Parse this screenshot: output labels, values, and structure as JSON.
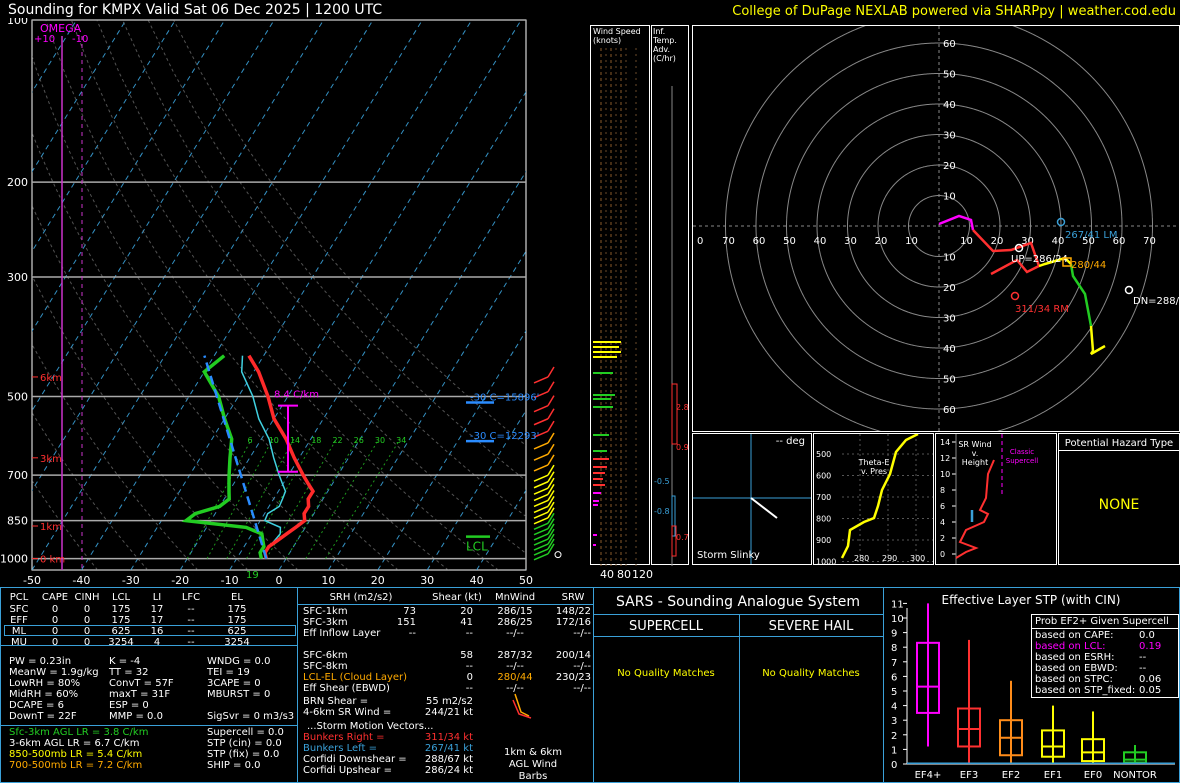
{
  "header": {
    "left": "Sounding for KMPX Valid  Sat 06 Dec 2025 | 1200 UTC",
    "right": "College of DuPage NEXLAB powered via SHARPpy | weather.cod.edu"
  },
  "colors": {
    "temp": "#ff2a2a",
    "dew": "#22cc22",
    "wet": "#40d0e0",
    "accent_yellow": "#ffff00",
    "omega": "#ff00ff",
    "frame": "#3aa0d8"
  },
  "chart_data": [
    {
      "type": "line",
      "name": "skew-t",
      "ylabel": "",
      "yticks": [
        "100",
        "200",
        "300",
        "500",
        "700",
        "850",
        "1000"
      ],
      "ytick_values": [
        100,
        200,
        300,
        500,
        700,
        850,
        1000
      ],
      "xticks": [
        "-50",
        "-40",
        "-30",
        "-20",
        "-10",
        "0",
        "10",
        "20",
        "30",
        "40",
        "50"
      ],
      "xtick_values": [
        -50,
        -40,
        -30,
        -20,
        -10,
        0,
        10,
        20,
        30,
        40,
        50
      ],
      "xlim": [
        -50,
        50
      ],
      "ylim": [
        1050,
        100
      ],
      "omega_label": "OMEGA",
      "omega_ticks": [
        "+10",
        "-10"
      ],
      "heights": [
        "6km",
        "3km",
        "1km",
        "0 km"
      ],
      "height_p": [
        460,
        650,
        870,
        1000
      ],
      "lapse_label": "8.4 C/km",
      "lcl_label": "LCL",
      "sfc_label": "19",
      "isotherm_labels": [
        "-30 C=15896'",
        "-30 C=12293'"
      ],
      "mixratio_labels": [
        "6",
        "10",
        "14",
        "18",
        "22",
        "26",
        "30",
        "34"
      ],
      "series": [
        {
          "name": "temp",
          "p": [
            1000,
            975,
            950,
            925,
            900,
            875,
            850,
            825,
            800,
            775,
            750,
            725,
            700,
            650,
            600,
            550,
            500,
            450,
            420
          ],
          "t": [
            -4,
            -5,
            -5,
            -4,
            -3,
            -2,
            -1,
            -2,
            -2,
            -3,
            -3,
            -5,
            -7,
            -11,
            -15,
            -20,
            -24,
            -29,
            -33
          ]
        },
        {
          "name": "dew",
          "p": [
            1000,
            975,
            950,
            925,
            900,
            875,
            850,
            825,
            800,
            775,
            750,
            725,
            700,
            650,
            600,
            550,
            500,
            450,
            420
          ],
          "t": [
            -5,
            -6,
            -6,
            -7,
            -8,
            -12,
            -25,
            -24,
            -20,
            -19,
            -20,
            -21,
            -22,
            -24,
            -26,
            -30,
            -34,
            -40,
            -38
          ]
        }
      ]
    },
    {
      "type": "bar",
      "name": "wind-speed",
      "title": "Wind Speed (knots)",
      "xticks": [
        "40",
        "80",
        "120"
      ]
    },
    {
      "type": "bar",
      "name": "inferred-temp-adv",
      "title": "Inf. Temp. Adv.(C/hr)",
      "values": [
        2.8,
        0.9,
        -0.5,
        -0.8,
        0.7
      ],
      "labels": [
        "2.8",
        "0.9",
        "-0.5",
        "-0.8",
        "0.7"
      ]
    },
    {
      "type": "line",
      "name": "hodograph",
      "rings": [
        "10",
        "20",
        "30",
        "40",
        "50",
        "60",
        "70"
      ],
      "points": [
        {
          "label": "267/41 LM",
          "c": "#3aa0d8"
        },
        {
          "label": "UP=286/24",
          "c": "#ffffff"
        },
        {
          "label": "280/44",
          "c": "#ffaa00"
        },
        {
          "label": "311/34 RM",
          "c": "#ff3030"
        },
        {
          "label": "DN=288/6",
          "c": "#ffffff"
        }
      ]
    },
    {
      "type": "line",
      "name": "theta-e",
      "title": "Theta-E v. Pres",
      "yticks": [
        "500",
        "600",
        "700",
        "800",
        "900",
        "1000"
      ],
      "xticks": [
        "280",
        "290",
        "300"
      ]
    },
    {
      "type": "line",
      "name": "sr-wind",
      "title": "SR Wind v. Height",
      "yticks": [
        "14",
        "12",
        "10",
        "8",
        "6",
        "4",
        "2",
        "0"
      ],
      "note": "Classic Supercell"
    },
    {
      "type": "bar",
      "name": "stp",
      "title": "Effective Layer STP (with CIN)",
      "categories": [
        "EF4+",
        "EF3",
        "EF2",
        "EF1",
        "EF0",
        "NONTOR"
      ],
      "yticks": [
        "0",
        "1",
        "2",
        "3",
        "4",
        "5",
        "6",
        "7",
        "8",
        "9",
        "10",
        "11"
      ],
      "ylim": [
        0,
        11
      ]
    }
  ],
  "slinky": {
    "label": "Storm Slinky",
    "deg": "-- deg"
  },
  "hazard": {
    "title": "Potential Hazard Type",
    "value": "NONE"
  },
  "parcels": {
    "headers": [
      "PCL",
      "CAPE",
      "CINH",
      "LCL",
      "LI",
      "LFC",
      "EL"
    ],
    "rows": [
      [
        "SFC",
        "0",
        "0",
        "175",
        "17",
        "--",
        "175"
      ],
      [
        "EFF",
        "0",
        "0",
        "175",
        "17",
        "--",
        "175"
      ],
      [
        "ML",
        "0",
        "0",
        "625",
        "16",
        "--",
        "625"
      ],
      [
        "MU",
        "0",
        "0",
        "3254",
        "4",
        "--",
        "3254"
      ]
    ]
  },
  "indices": [
    [
      "PW = 0.23in",
      "K = -4",
      "WNDG = 0.0"
    ],
    [
      "MeanW = 1.9g/kg",
      "TT = 32",
      "TEI = 19"
    ],
    [
      "LowRH = 80%",
      "ConvT = 57F",
      "3CAPE = 0"
    ],
    [
      "MidRH = 60%",
      "maxT = 31F",
      "MBURST = 0"
    ],
    [
      "DCAPE = 6",
      "ESP = 0",
      ""
    ],
    [
      "DownT = 22F",
      "MMP = 0.0",
      "SigSvr = 0 m3/s3"
    ]
  ],
  "lapse": [
    {
      "t": "Sfc-3km AGL LR = 3.8 C/km",
      "c": "#22cc22"
    },
    {
      "t": "3-6km AGL LR = 6.7 C/km",
      "c": "#ffffff"
    },
    {
      "t": "850-500mb LR = 5.4 C/km",
      "c": "#ffff00"
    },
    {
      "t": "700-500mb LR = 7.2 C/km",
      "c": "#ffaa00"
    }
  ],
  "composites": [
    "Supercell = 0.0",
    "STP (cin) = 0.0",
    "STP (fix) = 0.0",
    "SHIP = 0.0"
  ],
  "kinem": {
    "headers": [
      "SRH (m2/s2)",
      "Shear (kt)",
      "MnWind",
      "SRW"
    ],
    "rows": [
      {
        "l": "SFC-1km",
        "a": "73",
        "b": "20",
        "c": "286/15",
        "d": "148/22",
        "col": "#fff"
      },
      {
        "l": "SFC-3km",
        "a": "151",
        "b": "41",
        "c": "286/25",
        "d": "172/16",
        "col": "#fff"
      },
      {
        "l": "Eff Inflow Layer",
        "a": "--",
        "b": "--",
        "c": "--/--",
        "d": "--/--",
        "col": "#fff"
      },
      {
        "l": "",
        "a": "",
        "b": "",
        "c": "",
        "d": "",
        "col": "#fff"
      },
      {
        "l": "SFC-6km",
        "a": "",
        "b": "58",
        "c": "287/32",
        "d": "200/14",
        "col": "#fff"
      },
      {
        "l": "SFC-8km",
        "a": "",
        "b": "--",
        "c": "--/--",
        "d": "--/--",
        "col": "#fff"
      },
      {
        "l": "LCL-EL (Cloud Layer)",
        "a": "",
        "b": "0",
        "c": "280/44",
        "d": "230/23",
        "col": "#ffaa00"
      },
      {
        "l": "Eff Shear (EBWD)",
        "a": "",
        "b": "--",
        "c": "--/--",
        "d": "--/--",
        "col": "#fff"
      }
    ],
    "brn": "BRN Shear =",
    "brn_v": "55 m2/s2",
    "sr46": "4-6km SR Wind =",
    "sr46_v": "244/21 kt",
    "storm_title": "...Storm Motion Vectors...",
    "motions": [
      {
        "l": "Bunkers Right =",
        "v": "311/34 kt",
        "c": "#ff3030"
      },
      {
        "l": "Bunkers Left =",
        "v": "267/41 kt",
        "c": "#3aa0d8"
      },
      {
        "l": "Corfidi Downshear =",
        "v": "288/67 kt",
        "c": "#ffffff"
      },
      {
        "l": "Corfidi Upshear =",
        "v": "286/24 kt",
        "c": "#ffffff"
      }
    ],
    "barbs": "1km & 6km AGL Wind Barbs"
  },
  "sars": {
    "title": "SARS - Sounding Analogue System",
    "left": "SUPERCELL",
    "right": "SEVERE HAIL",
    "lm": "No Quality Matches",
    "rm": "No Quality Matches"
  },
  "ef": {
    "box_title": "Prob EF2+ Given Supercell",
    "rows": [
      {
        "l": "based on CAPE:",
        "v": "0.0",
        "c": "#fff"
      },
      {
        "l": "based on LCL:",
        "v": "0.19",
        "c": "#ff00ff"
      },
      {
        "l": "based on ESRH:",
        "v": "--",
        "c": "#fff"
      },
      {
        "l": "based on EBWD:",
        "v": "--",
        "c": "#fff"
      },
      {
        "l": "based on STPC:",
        "v": "0.06",
        "c": "#fff"
      },
      {
        "l": "based on STP_fixed:",
        "v": "0.05",
        "c": "#fff"
      }
    ]
  }
}
